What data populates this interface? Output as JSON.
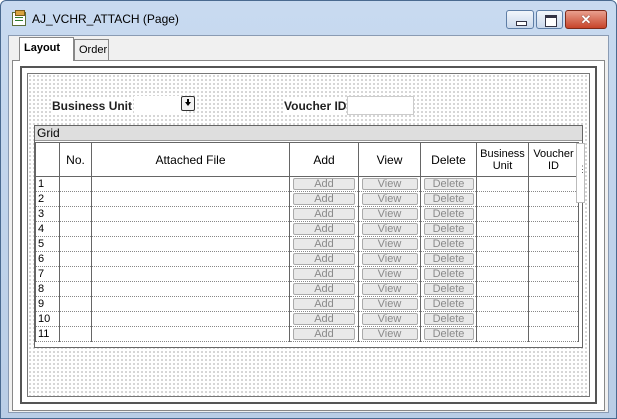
{
  "window": {
    "title": "AJ_VCHR_ATTACH (Page)",
    "close_glyph": "✕"
  },
  "tabs": [
    {
      "label": "Layout",
      "active": true
    },
    {
      "label": "Order",
      "active": false
    }
  ],
  "form": {
    "business_unit_label": "Business Unit",
    "voucher_id_label": "Voucher ID"
  },
  "grid": {
    "title": "Grid",
    "columns": [
      "",
      "No.",
      "Attached File",
      "Add",
      "View",
      "Delete",
      "Business Unit",
      "Voucher ID"
    ],
    "button_labels": {
      "add": "Add",
      "view": "View",
      "delete": "Delete"
    },
    "rows": [
      "1",
      "2",
      "3",
      "4",
      "5",
      "6",
      "7",
      "8",
      "9",
      "10",
      "11"
    ]
  }
}
